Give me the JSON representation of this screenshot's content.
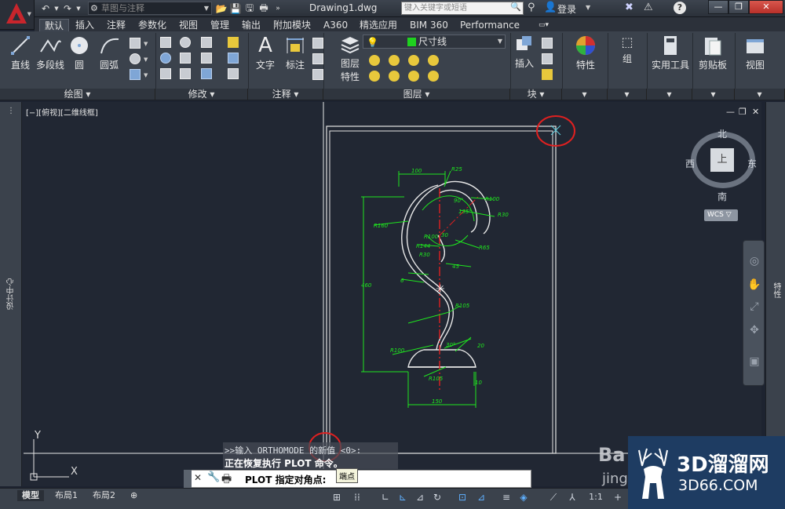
{
  "titlebar": {
    "workspace": "草图与注释",
    "doc_title": "Drawing1.dwg",
    "search_placeholder": "键入关键字或短语",
    "login": "登录"
  },
  "ribbon_tabs": [
    "默认",
    "插入",
    "注释",
    "参数化",
    "视图",
    "管理",
    "输出",
    "附加模块",
    "A360",
    "精选应用",
    "BIM 360",
    "Performance"
  ],
  "ribbon": {
    "draw": {
      "line": "直线",
      "polyline": "多段线",
      "circle": "圆",
      "arc": "圆弧",
      "panel": "绘图"
    },
    "modify": {
      "panel": "修改"
    },
    "annotation": {
      "text": "文字",
      "dimension": "标注",
      "panel": "注释"
    },
    "layers": {
      "properties": "图层",
      "properties2": "特性",
      "current_layer": "尺寸线",
      "panel": "图层"
    },
    "block": {
      "insert": "插入",
      "panel": "块"
    },
    "properties": {
      "label": "特性"
    },
    "groups": {
      "label": "组"
    },
    "utilities": {
      "label": "实用工具"
    },
    "clipboard": {
      "label": "剪贴板"
    },
    "view": {
      "label": "视图"
    }
  },
  "viewport": {
    "label": "[−][俯视][二维线框]",
    "left_panel": "设计中心",
    "right_panel": "特性"
  },
  "viewcube": {
    "north": "北",
    "south": "南",
    "east": "东",
    "west": "西",
    "top": "上",
    "wcs": "WCS"
  },
  "ucs": {
    "x": "X",
    "y": "Y"
  },
  "dimensions": {
    "d100": "100",
    "r25": "R25",
    "r100a": "R100",
    "a135": "135°",
    "a90": "90°",
    "r30a": "R30",
    "r160": "R160",
    "r100b": "R100",
    "d30": "30",
    "r144": "R144",
    "r30b": "R30",
    "r65": "R65",
    "d45": "45",
    "d6": "6",
    "d460": "460",
    "r105a": "R105",
    "r100c": "R100",
    "a30": "30°",
    "d20": "20",
    "r105b": "R105",
    "d10": "10",
    "d150": "150"
  },
  "command": {
    "history1": ">>输入 ORTHOMODE 的新值 <0>:",
    "history2": "正在恢复执行 PLOT 命令。",
    "prompt": "PLOT 指定对角点:",
    "tooltip": "端点"
  },
  "layout_tabs": [
    "模型",
    "布局1",
    "布局2"
  ],
  "status": {
    "scale": "1:1"
  },
  "watermarks": {
    "baidu1": "Ba",
    "baidu2": "jing",
    "site1": "3D溜溜网",
    "site2": "3D66.COM"
  },
  "colors": {
    "accent_red": "#c8252c",
    "dim_green": "#1fe61f",
    "center_red": "#e02020",
    "canvas": "#212733"
  }
}
